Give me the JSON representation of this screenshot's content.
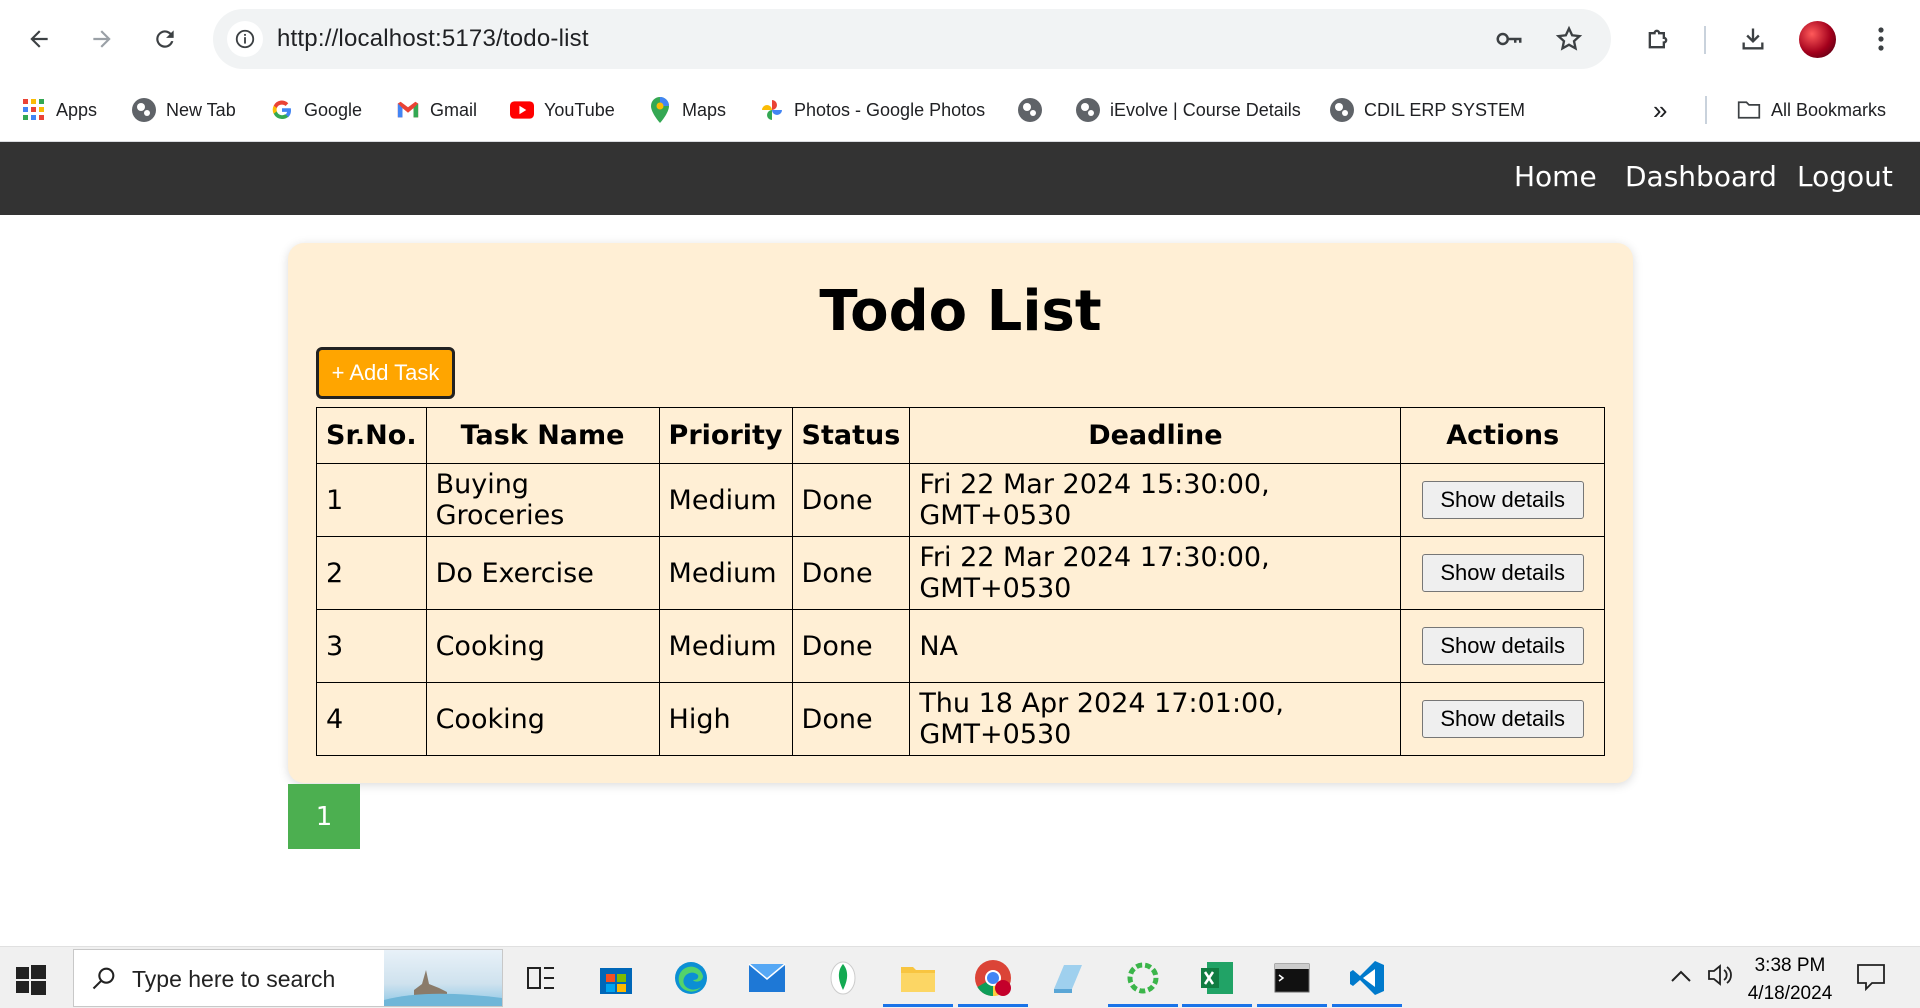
{
  "browser": {
    "url": "http://localhost:5173/todo-list",
    "bookmarks": [
      {
        "label": "Apps",
        "icon": "apps-grid-icon"
      },
      {
        "label": "New Tab",
        "icon": "globe-icon"
      },
      {
        "label": "Google",
        "icon": "google-icon"
      },
      {
        "label": "Gmail",
        "icon": "gmail-icon"
      },
      {
        "label": "YouTube",
        "icon": "youtube-icon"
      },
      {
        "label": "Maps",
        "icon": "maps-icon"
      },
      {
        "label": "Photos - Google Photos",
        "icon": "photos-icon"
      },
      {
        "label": "",
        "icon": "globe-icon"
      },
      {
        "label": "iEvolve | Course Details",
        "icon": "globe-icon"
      },
      {
        "label": "CDIL ERP SYSTEM",
        "icon": "globe-icon"
      }
    ],
    "all_bookmarks": "All Bookmarks",
    "more_bookmarks": "»"
  },
  "app": {
    "nav": {
      "home": "Home",
      "dashboard": "Dashboard",
      "logout": "Logout"
    },
    "title": "Todo List",
    "add_task": "+ Add Task",
    "columns": [
      "Sr.No.",
      "Task Name",
      "Priority",
      "Status",
      "Deadline",
      "Actions"
    ],
    "rows": [
      {
        "sr": "1",
        "name": "Buying Groceries",
        "priority": "Medium",
        "status": "Done",
        "deadline": "Fri 22 Mar 2024 15:30:00, GMT+0530",
        "action": "Show details"
      },
      {
        "sr": "2",
        "name": "Do Exercise",
        "priority": "Medium",
        "status": "Done",
        "deadline": "Fri 22 Mar 2024 17:30:00, GMT+0530",
        "action": "Show details"
      },
      {
        "sr": "3",
        "name": "Cooking",
        "priority": "Medium",
        "status": "Done",
        "deadline": "NA",
        "action": "Show details"
      },
      {
        "sr": "4",
        "name": "Cooking",
        "priority": "High",
        "status": "Done",
        "deadline": "Thu 18 Apr 2024 17:01:00, GMT+0530",
        "action": "Show details"
      }
    ],
    "pagination": {
      "current": "1"
    }
  },
  "taskbar": {
    "search_placeholder": "Type here to search",
    "time": "3:38 PM",
    "date": "4/18/2024"
  },
  "colors": {
    "nav_bg": "#333333",
    "card_bg": "#ffefd5",
    "add_button": "#ffa500",
    "page_button": "#4caf50"
  }
}
